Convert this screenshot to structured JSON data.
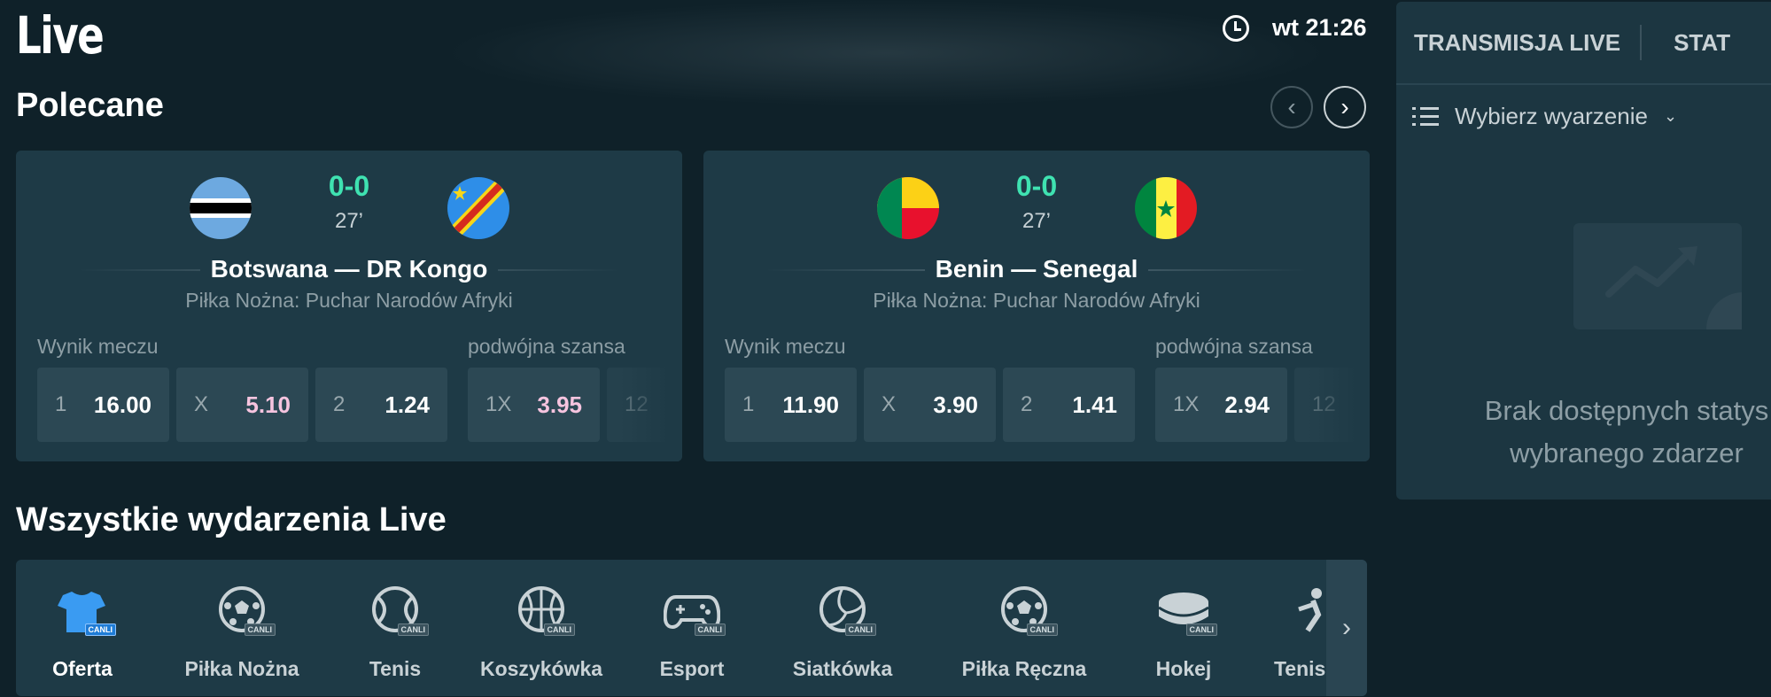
{
  "header": {
    "title": "Live",
    "time": "wt 21:26"
  },
  "featured": {
    "title": "Polecane",
    "matches": [
      {
        "home": "Botswana",
        "away": "DR Kongo",
        "teams": "Botswana — DR Kongo",
        "score": "0-0",
        "minute": "27’",
        "league": "Piłka Nożna: Puchar Narodów Afryki",
        "market_main": "Wynik meczu",
        "market_second": "podwójna szansa",
        "odds": [
          {
            "sel": "1",
            "val": "16.00"
          },
          {
            "sel": "X",
            "val": "5.10",
            "highlight": true
          },
          {
            "sel": "2",
            "val": "1.24"
          },
          {
            "sel": "1X",
            "val": "3.95",
            "highlight": true
          },
          {
            "sel": "12",
            "val": ""
          }
        ]
      },
      {
        "home": "Benin",
        "away": "Senegal",
        "teams": "Benin — Senegal",
        "score": "0-0",
        "minute": "27’",
        "league": "Piłka Nożna: Puchar Narodów Afryki",
        "market_main": "Wynik meczu",
        "market_second": "podwójna szansa",
        "odds": [
          {
            "sel": "1",
            "val": "11.90"
          },
          {
            "sel": "X",
            "val": "3.90"
          },
          {
            "sel": "2",
            "val": "1.41"
          },
          {
            "sel": "1X",
            "val": "2.94"
          },
          {
            "sel": "12",
            "val": ""
          }
        ]
      }
    ]
  },
  "all_live": {
    "title": "Wszystkie wydarzenia Live",
    "badge": "CANLI",
    "sports": [
      {
        "label": "Oferta",
        "icon": "jersey-icon",
        "active": true
      },
      {
        "label": "Piłka Nożna",
        "icon": "soccer-ball-icon"
      },
      {
        "label": "Tenis",
        "icon": "tennis-ball-icon"
      },
      {
        "label": "Koszykówka",
        "icon": "basketball-icon"
      },
      {
        "label": "Esport",
        "icon": "gamepad-icon"
      },
      {
        "label": "Siatkówka",
        "icon": "volleyball-icon"
      },
      {
        "label": "Piłka Ręczna",
        "icon": "handball-icon"
      },
      {
        "label": "Hokej",
        "icon": "hockey-puck-icon"
      },
      {
        "label": "Tenis S",
        "icon": "table-tennis-icon"
      }
    ]
  },
  "side_panel": {
    "tab_live": "TRANSMISJA LIVE",
    "tab_stats": "STAT",
    "select_event": "Wybierz wyarzenie",
    "no_stats_line1": "Brak dostępnych statys",
    "no_stats_line2": "wybranego zdarzer"
  },
  "colors": {
    "background": "#0f2129",
    "card": "#1e3a46",
    "score_green": "#3fe2b1",
    "odd_highlight_pink": "#f6c4df",
    "active_blue": "#1f7cd6"
  }
}
